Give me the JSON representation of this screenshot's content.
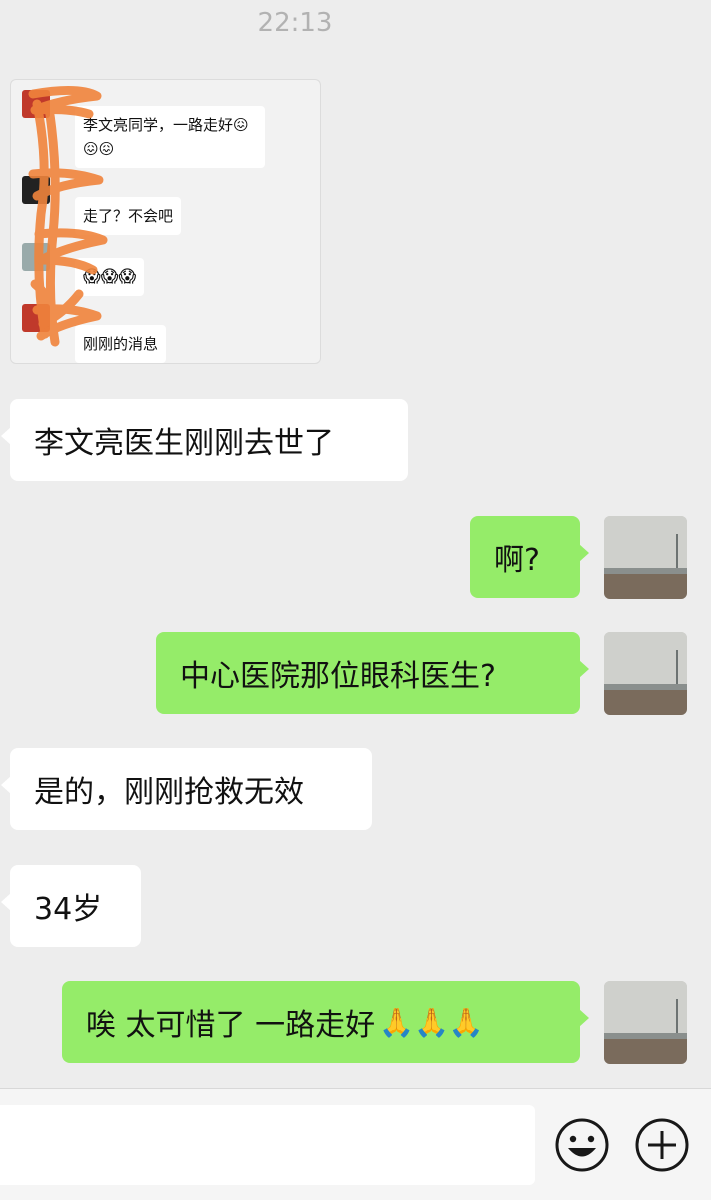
{
  "status": {
    "time": "22:13"
  },
  "forwarded": {
    "messages": [
      {
        "text": "李文亮同学，一路走好😖\n😖😖"
      },
      {
        "text": "走了？不会吧"
      },
      {
        "text": "😱😱😱"
      },
      {
        "text": "刚刚的消息"
      }
    ]
  },
  "messages": [
    {
      "text": "李文亮医生刚刚去世了"
    },
    {
      "text": "啊?"
    },
    {
      "text": "中心医院那位眼科医生?"
    },
    {
      "text": "是的，刚刚抢救无效"
    },
    {
      "text": "34岁"
    },
    {
      "text": "唉 太可惜了 一路走好",
      "emoji": "🙏🙏🙏"
    }
  ],
  "input": {
    "value": "",
    "emoji_icon": "smile-face-icon",
    "plus_icon": "plus-circle-icon"
  },
  "colors": {
    "background": "#ededed",
    "outgoing": "#95ec69",
    "incoming": "#ffffff",
    "scribble": "#f0843c"
  }
}
